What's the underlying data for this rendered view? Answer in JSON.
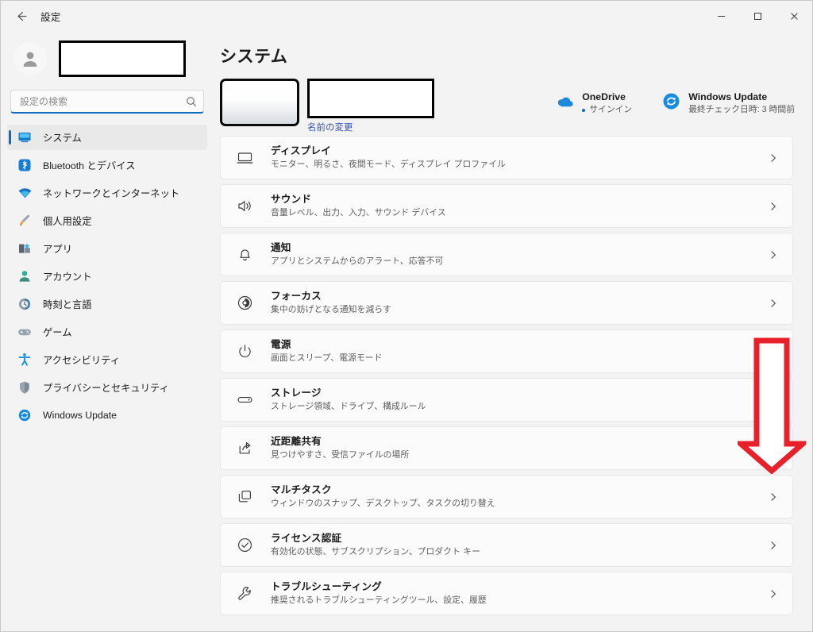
{
  "window": {
    "title": "設定",
    "back_icon": "back-arrow-icon",
    "controls": {
      "minimize": "minimize-icon",
      "maximize": "maximize-icon",
      "close": "close-icon"
    }
  },
  "sidebar": {
    "profile": {
      "avatar_icon": "person-avatar-icon",
      "account_name": ""
    },
    "search": {
      "placeholder": "設定の検索",
      "value": "",
      "icon": "search-icon"
    },
    "items": [
      {
        "label": "システム",
        "icon": "system-monitor-icon",
        "selected": true
      },
      {
        "label": "Bluetooth とデバイス",
        "icon": "bluetooth-icon",
        "selected": false
      },
      {
        "label": "ネットワークとインターネット",
        "icon": "wifi-icon",
        "selected": false
      },
      {
        "label": "個人用設定",
        "icon": "paintbrush-icon",
        "selected": false
      },
      {
        "label": "アプリ",
        "icon": "apps-icon",
        "selected": false
      },
      {
        "label": "アカウント",
        "icon": "account-person-icon",
        "selected": false
      },
      {
        "label": "時刻と言語",
        "icon": "clock-icon",
        "selected": false
      },
      {
        "label": "ゲーム",
        "icon": "gamepad-icon",
        "selected": false
      },
      {
        "label": "アクセシビリティ",
        "icon": "accessibility-icon",
        "selected": false
      },
      {
        "label": "プライバシーとセキュリティ",
        "icon": "shield-icon",
        "selected": false
      },
      {
        "label": "Windows Update",
        "icon": "update-refresh-icon",
        "selected": false
      }
    ]
  },
  "main": {
    "page_title": "システム",
    "device": {
      "image_icon": "device-thumbnail-redacted",
      "name": "",
      "rename_link": "名前の変更"
    },
    "quicklinks": [
      {
        "title": "OneDrive",
        "subtitle": "サインイン",
        "icon": "onedrive-cloud-icon",
        "has_dot": true
      },
      {
        "title": "Windows Update",
        "subtitle": "最終チェック日時: 3 時間前",
        "icon": "update-refresh-icon",
        "has_dot": false
      }
    ],
    "cards": [
      {
        "title": "ディスプレイ",
        "subtitle": "モニター、明るさ、夜間モード、ディスプレイ プロファイル",
        "icon": "display-monitor-icon"
      },
      {
        "title": "サウンド",
        "subtitle": "音量レベル、出力、入力、サウンド デバイス",
        "icon": "speaker-sound-icon"
      },
      {
        "title": "通知",
        "subtitle": "アプリとシステムからのアラート、応答不可",
        "icon": "bell-notification-icon"
      },
      {
        "title": "フォーカス",
        "subtitle": "集中の妨げとなる通知を減らす",
        "icon": "focus-moon-icon"
      },
      {
        "title": "電源",
        "subtitle": "画面とスリープ、電源モード",
        "icon": "power-icon"
      },
      {
        "title": "ストレージ",
        "subtitle": "ストレージ領域、ドライブ、構成ルール",
        "icon": "storage-drive-icon"
      },
      {
        "title": "近距離共有",
        "subtitle": "見つけやすさ、受信ファイルの場所",
        "icon": "nearby-share-icon"
      },
      {
        "title": "マルチタスク",
        "subtitle": "ウィンドウのスナップ、デスクトップ、タスクの切り替え",
        "icon": "multitask-windows-icon"
      },
      {
        "title": "ライセンス認証",
        "subtitle": "有効化の状態、サブスクリプション、プロダクト キー",
        "icon": "check-circle-icon"
      },
      {
        "title": "トラブルシューティング",
        "subtitle": "推奨されるトラブルシューティングツール、設定、履歴",
        "icon": "wrench-icon"
      }
    ],
    "chevron_icon": "chevron-right-icon"
  },
  "annotation": {
    "arrow": {
      "icon": "down-arrow-annotation",
      "color": "#e8202a",
      "direction": "down"
    }
  },
  "colors": {
    "accent": "#0f6cbd",
    "window_bg": "#f3f3f3",
    "card_bg": "#fbfbfb",
    "annotation_red": "#e8202a",
    "link_blue": "#3a53b0"
  }
}
